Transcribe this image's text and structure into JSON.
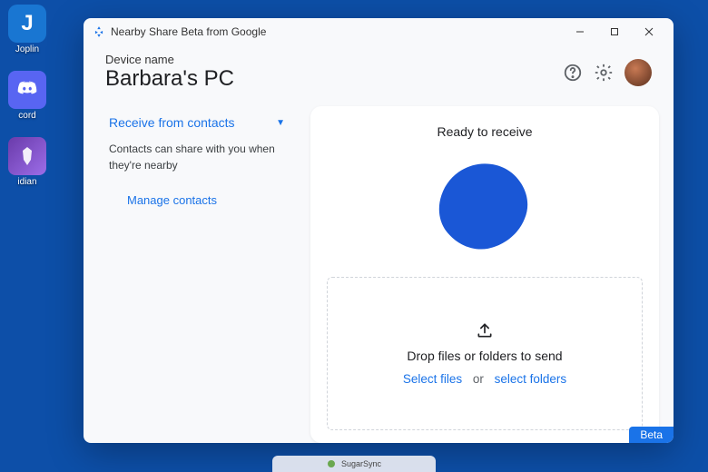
{
  "desktop": {
    "icons": [
      {
        "label": "Joplin"
      },
      {
        "label": "cord"
      },
      {
        "label": "idian"
      }
    ]
  },
  "window": {
    "title": "Nearby Share Beta from Google",
    "device_label": "Device name",
    "device_name": "Barbara's PC",
    "beta_badge": "Beta"
  },
  "left": {
    "dropdown_label": "Receive from contacts",
    "description": "Contacts can share with you when they're nearby",
    "manage_label": "Manage contacts"
  },
  "right": {
    "ready_label": "Ready to receive",
    "drop_text": "Drop files or folders to send",
    "select_files": "Select files",
    "or": "or",
    "select_folders": "select folders"
  },
  "colors": {
    "accent": "#1a73e8"
  },
  "taskbar": {
    "label": "SugarSync"
  }
}
